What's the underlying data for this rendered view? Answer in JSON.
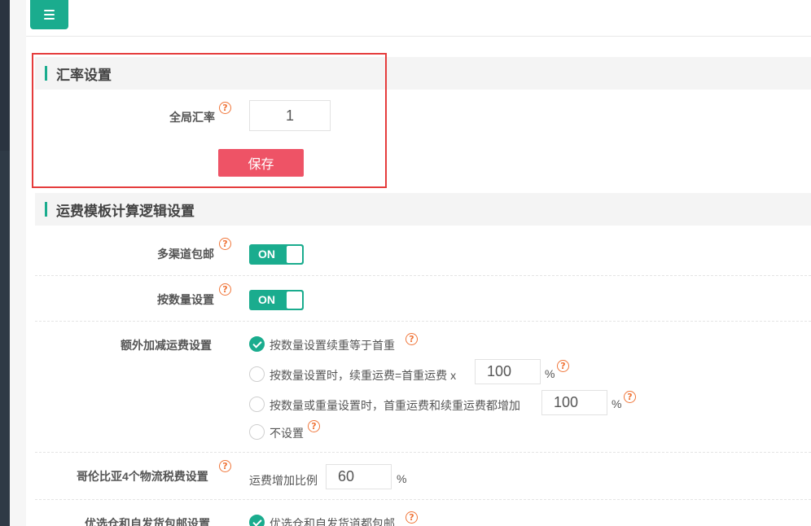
{
  "topbar": {
    "menu_icon": "hamburger-menu-icon"
  },
  "exchange": {
    "section_title": "汇率设置",
    "global_rate_label": "全局汇率",
    "global_rate_value": "1",
    "save_label": "保存"
  },
  "shipping": {
    "section_title": "运费模板计算逻辑设置",
    "multi_channel_label": "多渠道包邮",
    "multi_channel_state": "ON",
    "by_quantity_label": "按数量设置",
    "by_quantity_state": "ON",
    "extra_label": "额外加减运费设置",
    "options": [
      {
        "text": "按数量设置续重等于首重",
        "checked": true
      },
      {
        "text": "按数量设置时，续重运费=首重运费 x",
        "value": "100",
        "suffix": "%",
        "checked": false
      },
      {
        "text": "按数量或重量设置时，首重运费和续重运费都增加",
        "value": "100",
        "suffix": "%",
        "checked": false
      },
      {
        "text": "不设置",
        "checked": false
      }
    ],
    "colombia_label": "哥伦比亚4个物流税费设置",
    "colombia_prefix": "运费增加比例",
    "colombia_value": "60",
    "colombia_suffix": "%",
    "preferred_label": "优选仓和自发货包邮设置",
    "preferred_option": "优选仓和自发货道都包邮"
  },
  "colors": {
    "accent": "#1aac8e",
    "save": "#ee5366",
    "highlight": "#e53c3c",
    "help": "#f0763a"
  },
  "help_glyph": "?"
}
